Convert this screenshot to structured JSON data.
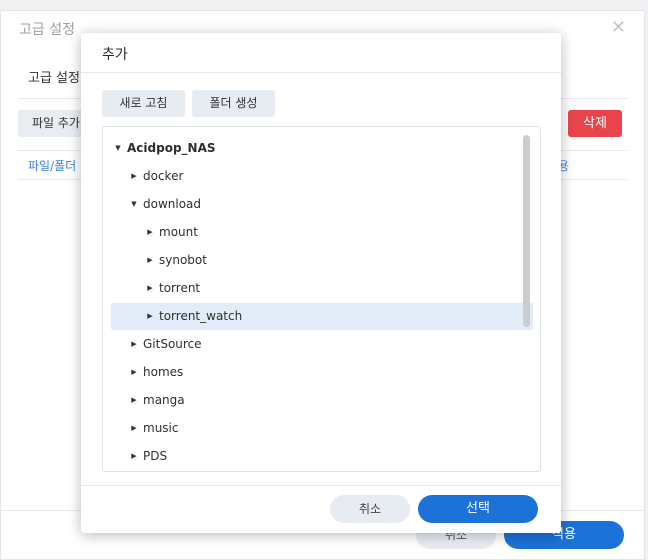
{
  "background_window": {
    "title": "고급 설정",
    "close_glyph": "✕",
    "tab_label": "고급 설정",
    "add_button_label": "파일 추가",
    "delete_button_label": "삭제",
    "column_left_label": "파일/폴더",
    "column_right_label": "용",
    "cancel_button_label": "취소",
    "apply_button_label": "적용"
  },
  "dialog": {
    "title": "추가",
    "toolbar": {
      "refresh_label": "새로 고침",
      "new_folder_label": "폴더 생성"
    },
    "tree": {
      "items": [
        {
          "label": "Acidpop_NAS",
          "level": 0,
          "expanded": true,
          "selected": false
        },
        {
          "label": "docker",
          "level": 1,
          "expanded": false,
          "selected": false
        },
        {
          "label": "download",
          "level": 1,
          "expanded": true,
          "selected": false
        },
        {
          "label": "mount",
          "level": 2,
          "expanded": false,
          "selected": false
        },
        {
          "label": "synobot",
          "level": 2,
          "expanded": false,
          "selected": false
        },
        {
          "label": "torrent",
          "level": 2,
          "expanded": false,
          "selected": false
        },
        {
          "label": "torrent_watch",
          "level": 2,
          "expanded": false,
          "selected": true
        },
        {
          "label": "GitSource",
          "level": 1,
          "expanded": false,
          "selected": false
        },
        {
          "label": "homes",
          "level": 1,
          "expanded": false,
          "selected": false
        },
        {
          "label": "manga",
          "level": 1,
          "expanded": false,
          "selected": false
        },
        {
          "label": "music",
          "level": 1,
          "expanded": false,
          "selected": false
        },
        {
          "label": "PDS",
          "level": 1,
          "expanded": false,
          "selected": false
        }
      ]
    },
    "footer": {
      "cancel_label": "취소",
      "select_label": "선택"
    }
  },
  "icons": {
    "expanded": "caret-down-icon",
    "collapsed": "caret-right-icon"
  },
  "colors": {
    "primary": "#1d72d8",
    "danger": "#e9444b",
    "selected_row": "#e2ecf8",
    "link": "#3a86d6"
  }
}
